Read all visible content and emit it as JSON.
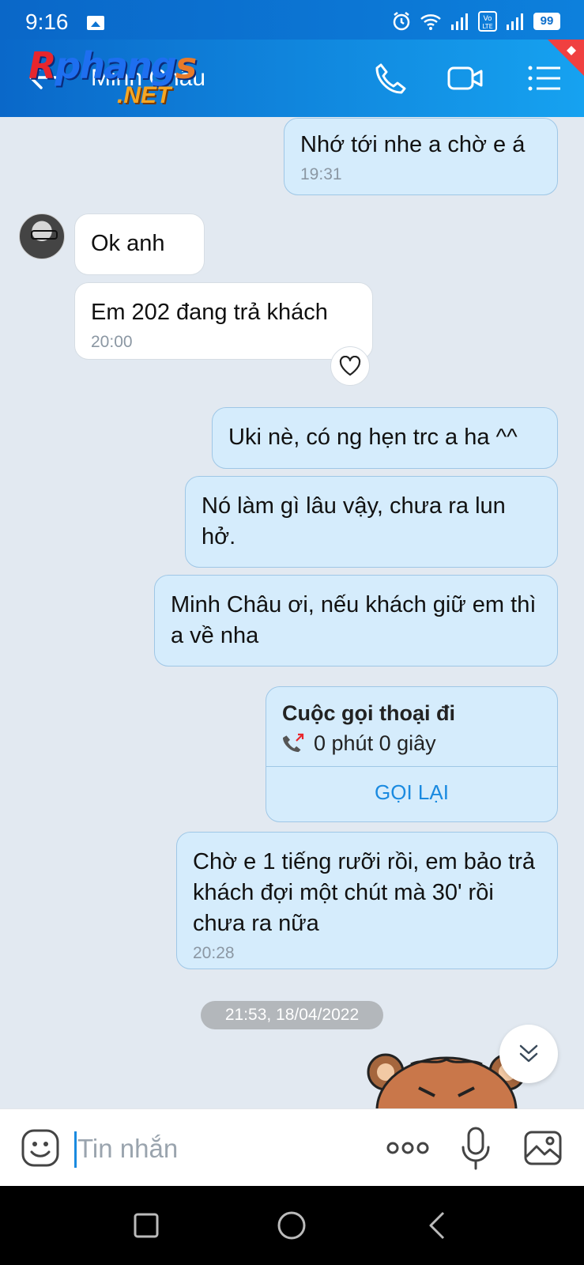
{
  "status_bar": {
    "time": "9:16",
    "battery": "99",
    "icons": [
      "gallery-icon",
      "alarm-icon",
      "wifi-icon",
      "signal-icon",
      "volte-icon",
      "signal-icon",
      "battery-icon"
    ]
  },
  "header": {
    "contact_name": "Minh Châu",
    "watermark": {
      "part1": "R",
      "part2": "phang",
      "part3": "s",
      "part4": ".NET"
    },
    "buttons": [
      "phone-icon",
      "video-icon",
      "menu-icon"
    ]
  },
  "messages": [
    {
      "direction": "out",
      "text": "Nhớ tới nhe a chờ e á",
      "time": "19:31"
    },
    {
      "direction": "in",
      "text": "Ok anh",
      "time": ""
    },
    {
      "direction": "in",
      "text": "Em 202 đang trả khách",
      "time": "20:00"
    },
    {
      "direction": "out",
      "text": "Uki nè, có ng hẹn trc a ha ^^",
      "time": ""
    },
    {
      "direction": "out",
      "text": "Nó làm gì lâu vậy, chưa ra lun hở.",
      "time": ""
    },
    {
      "direction": "out",
      "text": "Minh Châu ơi, nếu khách giữ em thì a về nha",
      "time": ""
    },
    {
      "direction": "out",
      "text": "Chờ e 1 tiếng rưỡi rồi, em bảo trả khách đợi một chút mà 30' rồi chưa ra nữa",
      "time": "20:28"
    }
  ],
  "call_card": {
    "title": "Cuộc gọi thoại đi",
    "duration": "0 phút 0 giây",
    "action": "GỌI LẠI"
  },
  "date_separator": "21:53, 18/04/2022",
  "input": {
    "placeholder": "Tin nhắn",
    "value": ""
  },
  "colors": {
    "header_start": "#0a68c9",
    "header_end": "#16a2f0",
    "outgoing_bubble": "#d5ecfc",
    "incoming_bubble": "#ffffff",
    "chat_background": "#e2e9f1",
    "accent": "#1a8ae0"
  }
}
